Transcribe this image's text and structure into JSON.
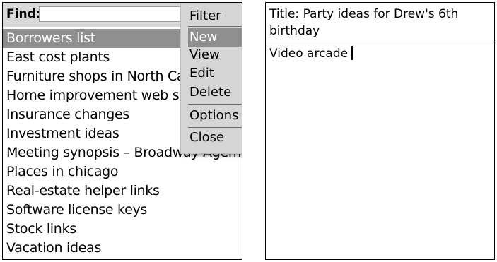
{
  "find": {
    "label": "Find:",
    "value": ""
  },
  "list": {
    "items": [
      {
        "label": "Borrowers list",
        "selected": true
      },
      {
        "label": "East cost plants",
        "selected": false
      },
      {
        "label": "Furniture shops in North Ca",
        "selected": false
      },
      {
        "label": "Home improvement web site",
        "selected": false
      },
      {
        "label": "Insurance changes",
        "selected": false
      },
      {
        "label": "Investment ideas",
        "selected": false
      },
      {
        "label": "Meeting synopsis – Broadway Agem",
        "selected": false
      },
      {
        "label": "Places in chicago",
        "selected": false
      },
      {
        "label": "Real-estate helper links",
        "selected": false
      },
      {
        "label": "Software license keys",
        "selected": false
      },
      {
        "label": "Stock links",
        "selected": false
      },
      {
        "label": "Vacation ideas",
        "selected": false
      }
    ]
  },
  "menu": {
    "items": [
      {
        "label": "Filter",
        "selected": false
      },
      {
        "label": "New",
        "selected": true
      },
      {
        "label": "View",
        "selected": false
      },
      {
        "label": "Edit",
        "selected": false
      },
      {
        "label": "Delete",
        "selected": false
      },
      {
        "label": "Options",
        "selected": false
      },
      {
        "label": "Close",
        "selected": false
      }
    ]
  },
  "memo": {
    "title": "Title: Party ideas for Drew's 6th birthday",
    "body": "Video arcade"
  },
  "colors": {
    "highlight": "#8f8f8f",
    "menu_bg": "#d5d5d5",
    "findbar_bg": "#d9d9d9"
  }
}
